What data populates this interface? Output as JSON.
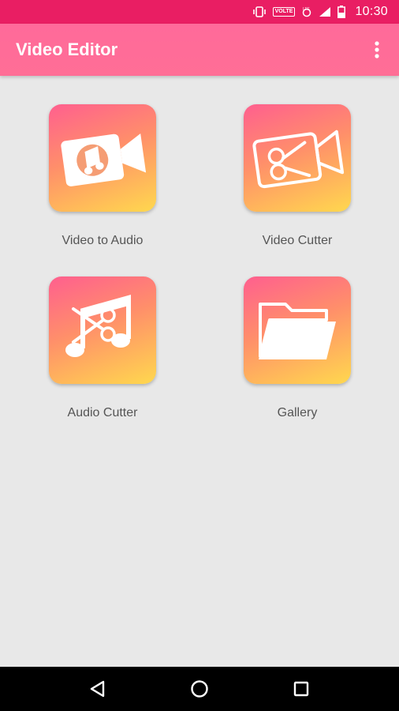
{
  "status_bar": {
    "time": "10:30",
    "volte_label": "VOLTE",
    "icons": [
      "vibrate-icon",
      "volte-icon",
      "lte-icon",
      "signal-icon",
      "battery-icon"
    ]
  },
  "app_bar": {
    "title": "Video Editor",
    "overflow_icon": "more-vert-icon"
  },
  "tiles": [
    {
      "label": "Video to Audio",
      "icon": "video-to-audio-icon"
    },
    {
      "label": "Video Cutter",
      "icon": "video-cutter-icon"
    },
    {
      "label": "Audio Cutter",
      "icon": "audio-cutter-icon"
    },
    {
      "label": "Gallery",
      "icon": "gallery-folder-icon"
    }
  ],
  "nav_bar": {
    "icons": [
      "back-icon",
      "home-icon",
      "recents-icon"
    ]
  },
  "colors": {
    "status_bar": "#e91e63",
    "app_bar": "#ff6e96",
    "tile_gradient_start": "#ff5f8f",
    "tile_gradient_end": "#ffd84e",
    "background": "#e8e8e8"
  }
}
